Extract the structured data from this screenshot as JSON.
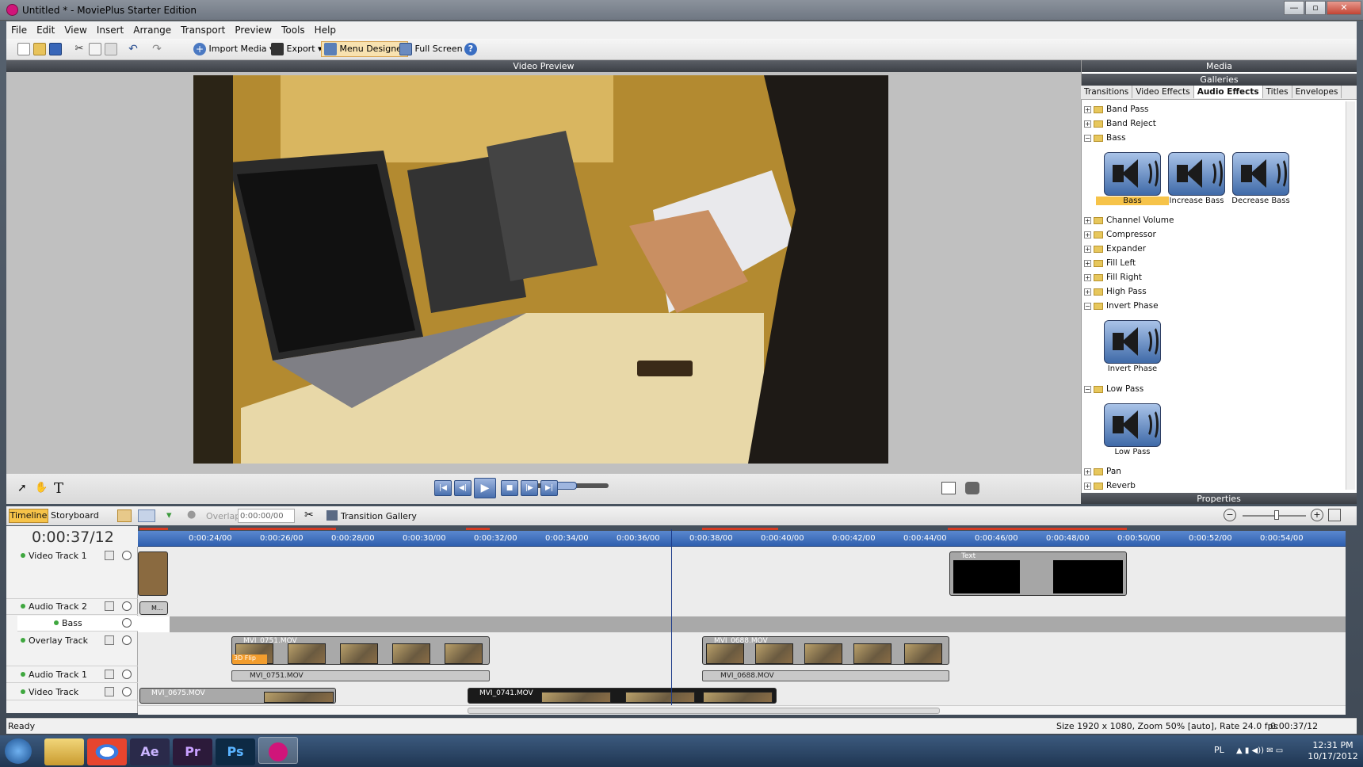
{
  "window": {
    "title": "Untitled * - MoviePlus Starter Edition",
    "minimize": "—",
    "maximize": "▫",
    "close": "✕"
  },
  "menu": [
    "File",
    "Edit",
    "View",
    "Insert",
    "Arrange",
    "Transport",
    "Preview",
    "Tools",
    "Help"
  ],
  "toolbar": {
    "import_media": "Import Media",
    "export": "Export",
    "menu_designer": "Menu Designer",
    "full_screen": "Full Screen"
  },
  "preview": {
    "header": "Video Preview"
  },
  "media_panel": {
    "header": "Media",
    "subheader": "Galleries",
    "tabs": [
      "Transitions",
      "Video Effects",
      "Audio Effects",
      "Titles",
      "Envelopes"
    ],
    "selected_tab": "Audio Effects",
    "tree": [
      {
        "label": "Band Pass",
        "expanded": false
      },
      {
        "label": "Band Reject",
        "expanded": false
      },
      {
        "label": "Bass",
        "expanded": true,
        "items": [
          "Bass",
          "Increase Bass",
          "Decrease Bass"
        ]
      },
      {
        "label": "Channel Volume",
        "expanded": false
      },
      {
        "label": "Compressor",
        "expanded": false
      },
      {
        "label": "Expander",
        "expanded": false
      },
      {
        "label": "Fill Left",
        "expanded": false
      },
      {
        "label": "Fill Right",
        "expanded": false
      },
      {
        "label": "High Pass",
        "expanded": false
      },
      {
        "label": "Invert Phase",
        "expanded": true,
        "items": [
          "Invert Phase"
        ]
      },
      {
        "label": "Low Pass",
        "expanded": true,
        "items": [
          "Low Pass"
        ]
      },
      {
        "label": "Pan",
        "expanded": false
      },
      {
        "label": "Reverb",
        "expanded": false
      }
    ],
    "properties": "Properties"
  },
  "timeline": {
    "tabs": [
      "Timeline",
      "Storyboard"
    ],
    "overlap_label": "Overlap",
    "overlap_value": "0:00:00/00",
    "transition_gallery": "Transition Gallery",
    "timecode": "0:00:37/12",
    "ruler": [
      "0:00:24/00",
      "0:00:26/00",
      "0:00:28/00",
      "0:00:30/00",
      "0:00:32/00",
      "0:00:34/00",
      "0:00:36/00",
      "0:00:38/00",
      "0:00:40/00",
      "0:00:42/00",
      "0:00:44/00",
      "0:00:46/00",
      "0:00:48/00",
      "0:00:50/00",
      "0:00:52/00",
      "0:00:54/00"
    ],
    "tracks": [
      "Video Track 1",
      "Audio Track 2",
      "Bass",
      "Overlay Track",
      "Audio Track 1",
      "Video Track"
    ],
    "clips": {
      "text": "Text",
      "overlay1": "MVI_0751.MOV",
      "overlay1_fx": "3D Flip",
      "overlay2": "MVI_0688.MOV",
      "audio1": "MVI_0751.MOV",
      "audio2": "MVI_0688.MOV",
      "video1": "MVI_0675.MOV",
      "video2": "MVI_0741.MOV",
      "track2_clip": "M..."
    }
  },
  "status": {
    "left": "Ready",
    "info": "Size 1920 x 1080, Zoom 50% [auto], Rate 24.0 fps",
    "time": "0:00:37/12"
  },
  "taskbar": {
    "lang": "PL",
    "clock_time": "12:31 PM",
    "clock_date": "10/17/2012",
    "apps": [
      "Ae",
      "Pr",
      "Ps"
    ]
  }
}
